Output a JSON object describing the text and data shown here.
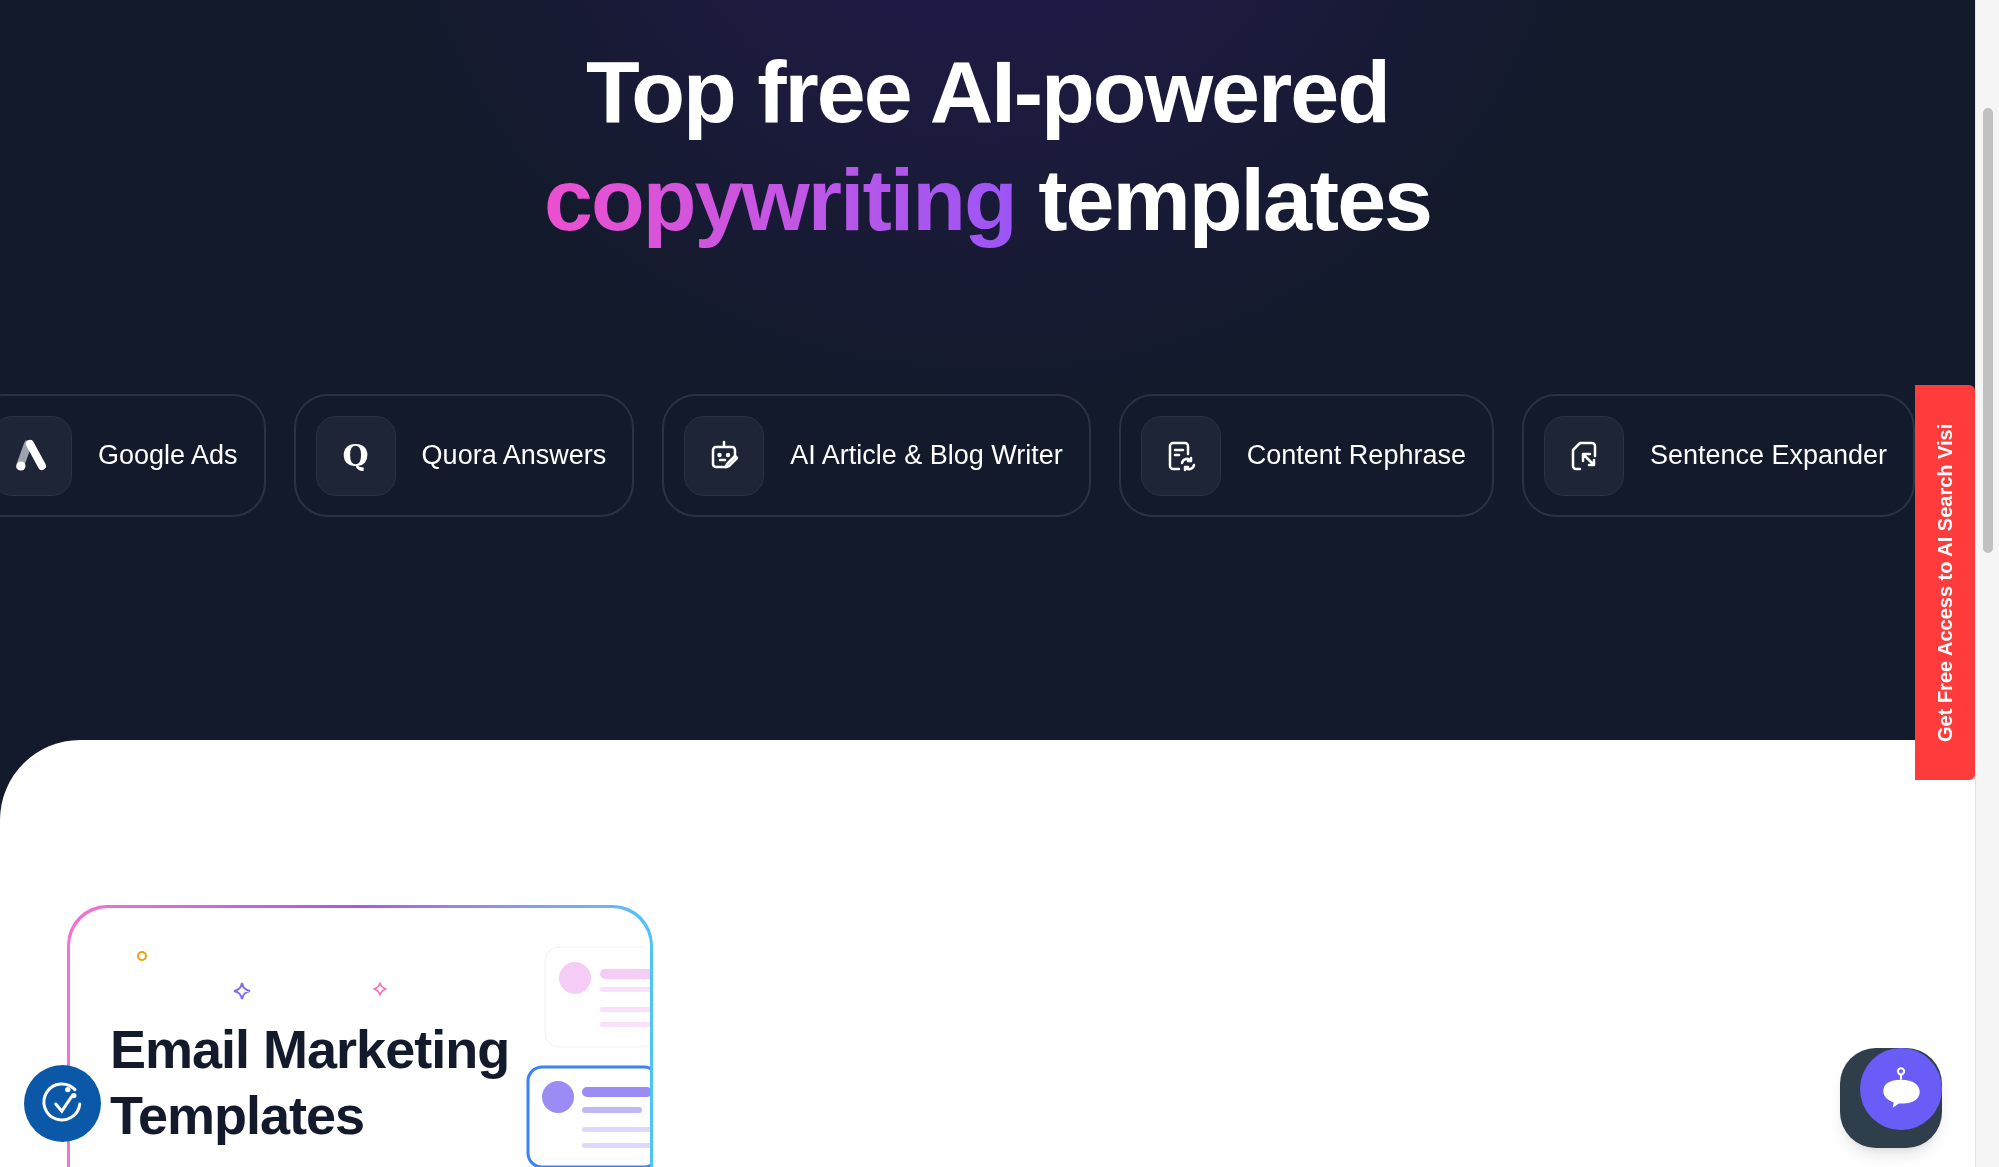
{
  "headline": {
    "line1": "Top free AI-powered",
    "highlight": "copywriting",
    "line2_rest": "templates"
  },
  "templates": [
    {
      "kind": "ads",
      "label": "Google Ads"
    },
    {
      "kind": "quora",
      "label": "Quora Answers",
      "icon_text": "Q"
    },
    {
      "kind": "robot",
      "label": "AI Article & Blog Writer"
    },
    {
      "kind": "rephrase",
      "label": "Content Rephrase"
    },
    {
      "kind": "expand",
      "label": "Sentence Expander"
    }
  ],
  "side_tab": {
    "label": "Get Free Access to AI Search Visi"
  },
  "card": {
    "title": "Email Marketing Templates"
  }
}
